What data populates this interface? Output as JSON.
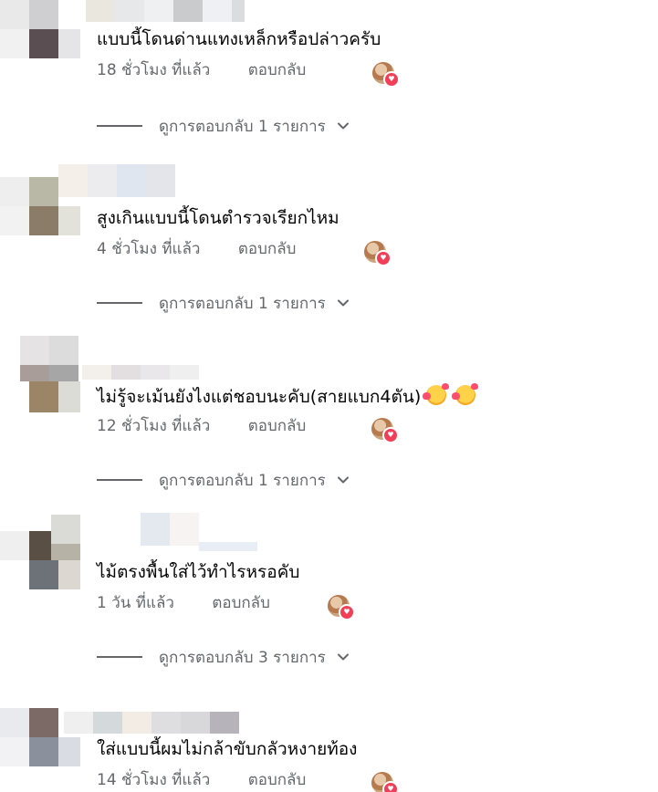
{
  "comments": [
    {
      "text": "แบบนี้โดนด่านแทงเหล็กหรือปล่าวครับ",
      "time": "18 ชั่วโมง ที่แล้ว",
      "reply": "ตอบกลับ",
      "view_replies": "ดูการตอบกลับ 1 รายการ",
      "has_emoji": false
    },
    {
      "text": "สูงเกินแบบนี้โดนตำรวจเรียกไหม",
      "time": "4 ชั่วโมง ที่แล้ว",
      "reply": "ตอบกลับ",
      "view_replies": "ดูการตอบกลับ 1 รายการ",
      "has_emoji": false
    },
    {
      "text": "ไม่รู้จะเม้นยังไงแต่ชอบนะคับ(สายแบก4ตัน)",
      "time": "12 ชั่วโมง ที่แล้ว",
      "reply": "ตอบกลับ",
      "view_replies": "ดูการตอบกลับ 1 รายการ",
      "has_emoji": true
    },
    {
      "text": "ไม้ตรงพื้นใส่ไว้ทำไรหรอคับ",
      "time": "1 วัน ที่แล้ว",
      "reply": "ตอบกลับ",
      "view_replies": "ดูการตอบกลับ 3 รายการ",
      "has_emoji": false
    },
    {
      "text": "ใส่แบบนี้ผมไม่กล้าขับกลัวหงายท้อง",
      "time": "14 ชั่วโมง ที่แล้ว",
      "reply": "ตอบกลับ",
      "view_replies": "",
      "has_emoji": false
    }
  ],
  "colors": {
    "text": "#050505",
    "secondary": "#65676b",
    "heart": "#f33e58"
  },
  "icons": [
    "reactor-avatar-icon",
    "heart-reaction-icon",
    "chevron-down-icon",
    "smiling-face-with-hearts-icon"
  ]
}
